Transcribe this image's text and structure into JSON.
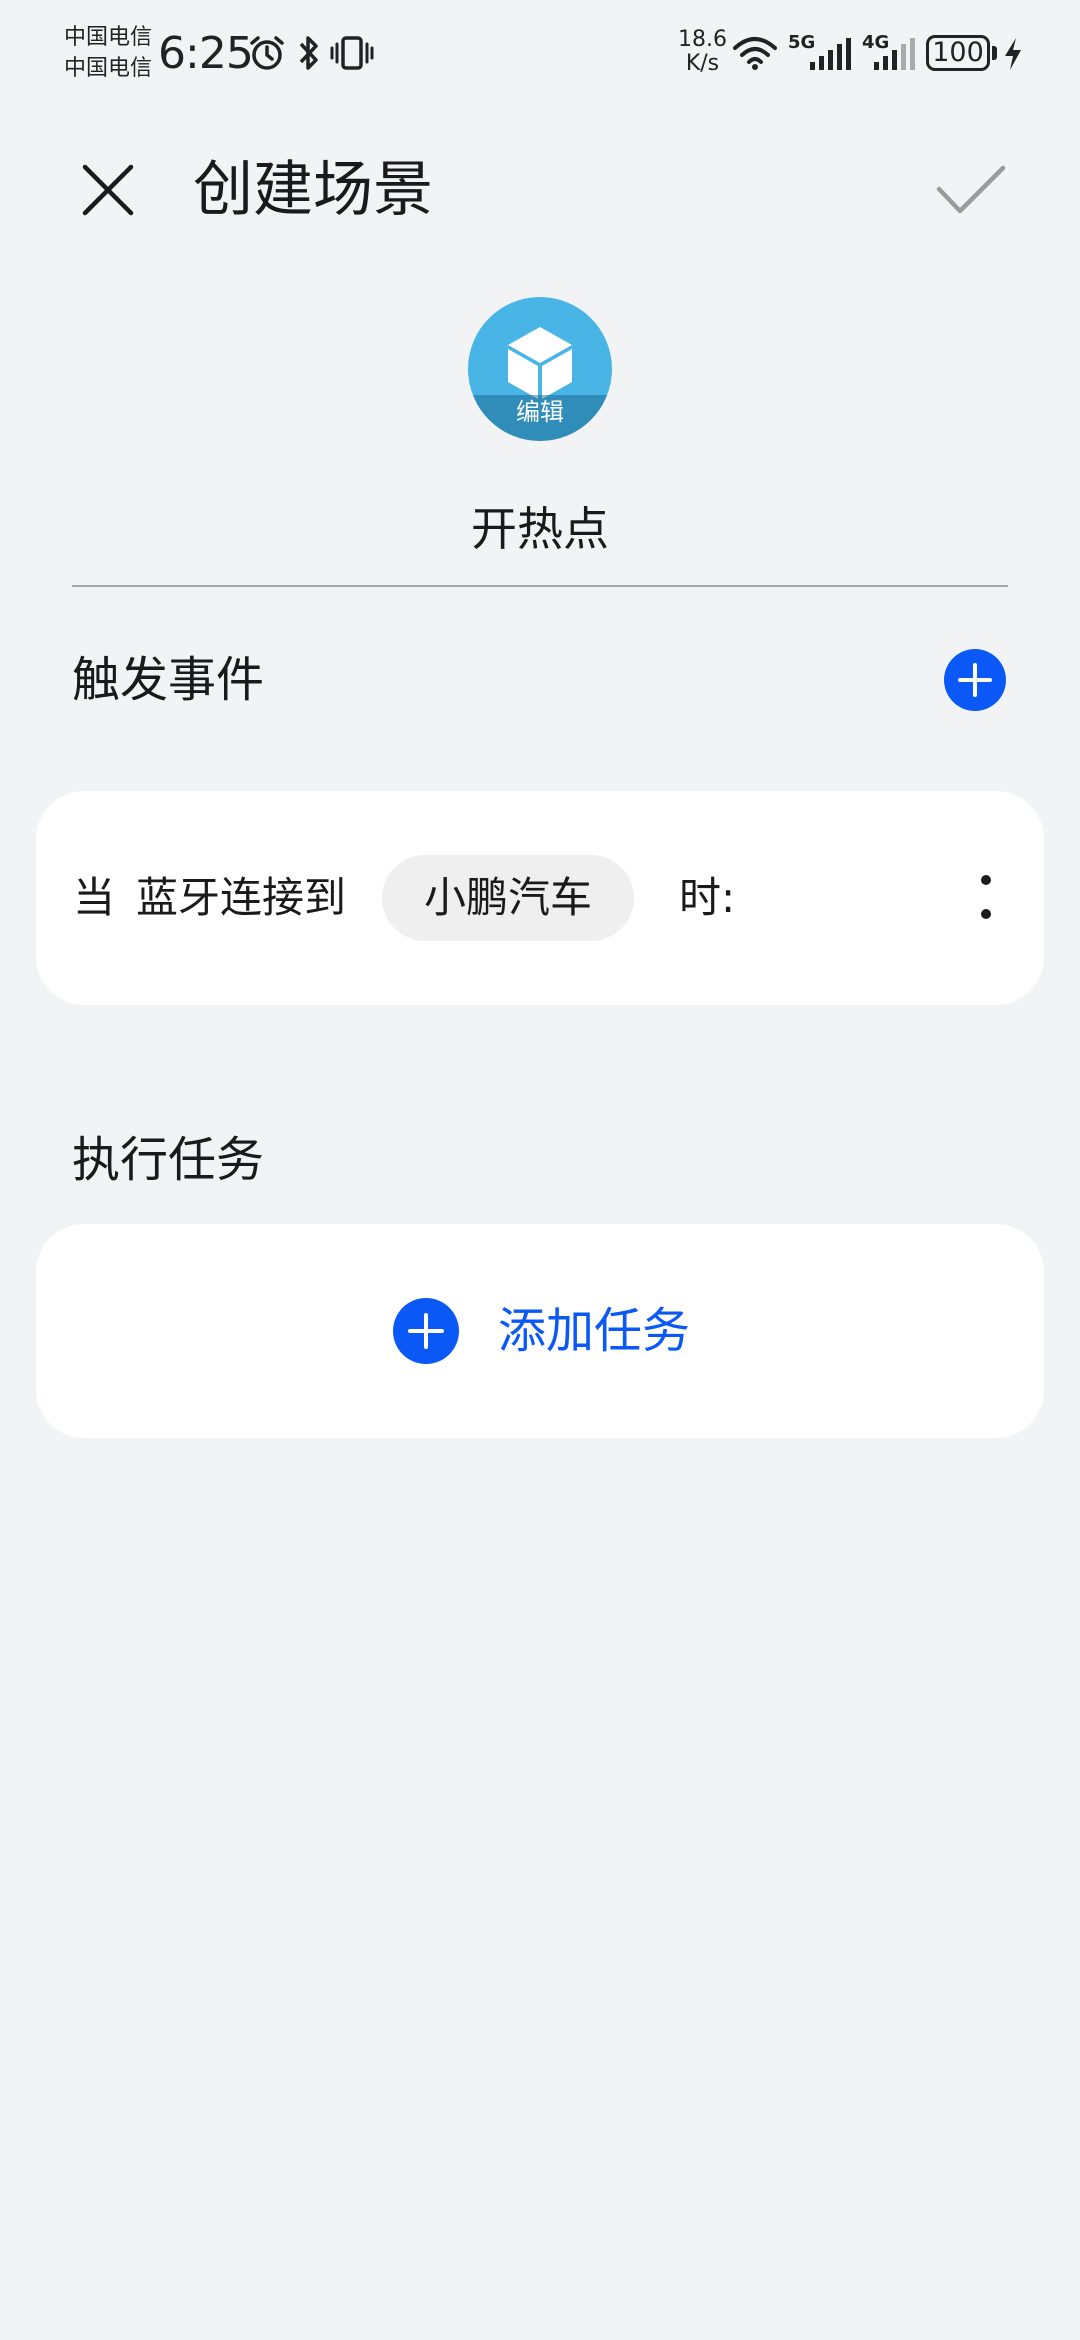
{
  "status_bar": {
    "carrier_1": "中国电信",
    "carrier_2": "中国电信",
    "time": "6:25",
    "net_speed_value": "18.6",
    "net_speed_unit": "K/s",
    "net_type_1": "5G",
    "net_type_2": "4G",
    "battery": "100",
    "icons": [
      "alarm-icon",
      "bluetooth-icon",
      "vibrate-icon",
      "wifi-icon",
      "signal-5g-icon",
      "signal-4g-icon",
      "battery-icon",
      "charging-icon"
    ]
  },
  "header": {
    "title": "创建场景",
    "close_icon": "close-icon",
    "confirm_icon": "check-icon"
  },
  "scene": {
    "icon_name": "cube-icon",
    "icon_color": "#48b5e6",
    "edit_label": "编辑",
    "name": "开热点"
  },
  "trigger_section": {
    "title": "触发事件",
    "add_icon": "plus-icon",
    "condition": {
      "prefix": "当",
      "event": "蓝牙连接到",
      "device": "小鹏汽车",
      "suffix": "时:"
    },
    "more_icon": "more-vertical-icon"
  },
  "task_section": {
    "title": "执行任务",
    "add_task_label": "添加任务",
    "add_icon": "plus-icon"
  },
  "colors": {
    "accent": "#0a59f7",
    "background": "#f1f3f5",
    "card": "#ffffff"
  }
}
